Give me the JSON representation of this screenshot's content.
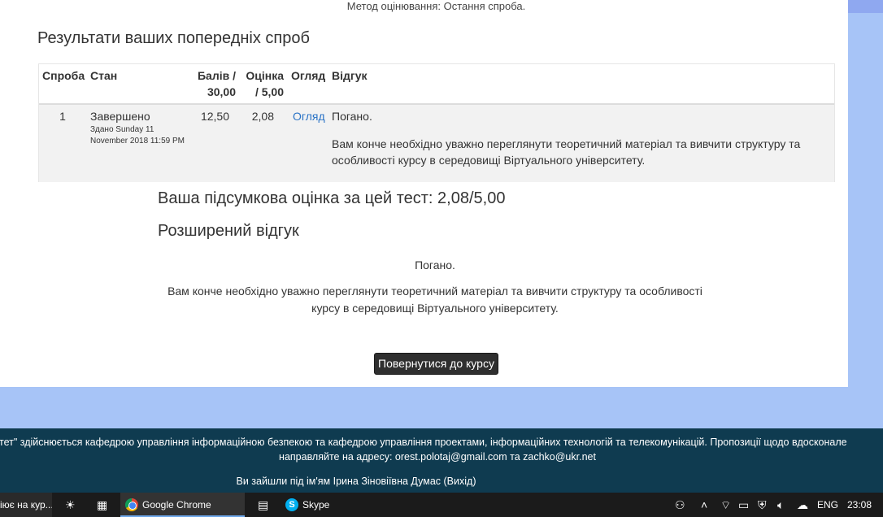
{
  "top": {
    "cut_text": "Метод оцінювання: Остання спроба."
  },
  "page": {
    "title": "Результати ваших попередніх спроб",
    "summary": "Ваша підсумкова оцінка за цей тест: 2,08/5,00",
    "extended_feedback_title": "Розширений відгук",
    "feedback_short": "Погано.",
    "feedback_long_1": "Вам конче необхідно уважно переглянути теоретичний матеріал та вивчити структуру та особливості",
    "feedback_long_2": "курсу в середовищі Віртуального університету.",
    "back_button": "Повернутися до курсу"
  },
  "table": {
    "headers": {
      "attempt": "Спроба",
      "state": "Стан",
      "marks_1": "Балів /",
      "marks_2": "30,00",
      "grade_1": "Оцінка",
      "grade_2": "/ 5,00",
      "review": "Огляд",
      "feedback": "Відгук"
    },
    "row": {
      "attempt": "1",
      "state": "Завершено",
      "submitted_1": "Здано Sunday 11",
      "submitted_2": "November 2018 11:59 PM",
      "marks": "12,50",
      "grade": "2,08",
      "review_link": "Огляд",
      "feedback_short": "Погано.",
      "feedback_long_1": "Вам конче необхідно уважно переглянути теоретичний матеріал та вивчити структуру та",
      "feedback_long_2": "особливості курсу в середовищі Віртуального університету."
    }
  },
  "footer": {
    "line1": "итет\" здійснюється кафедрою управління інформаційною безпекою та кафедрою управління проектами, інформаційних технологій та телекомунікацій. Пропозиції щодо вдоскона­ле",
    "line2": "направляйте на адресу: orest.polotaj@gmail.com та zachko@ukr.net",
    "line3": "Ви зайшли під ім'ям Ірина Зіновіївна Думас (Вихід)"
  },
  "taskbar": {
    "left_item": "іює на кур...",
    "chrome": "Google Chrome",
    "skype": "Skype",
    "lang": "ENG",
    "time": "23:08"
  },
  "colors": {
    "footer_bg": "#0f3b50",
    "page_bg": "#a7c4f7",
    "link": "#2a73c6",
    "button_bg": "#2f2f2f"
  }
}
